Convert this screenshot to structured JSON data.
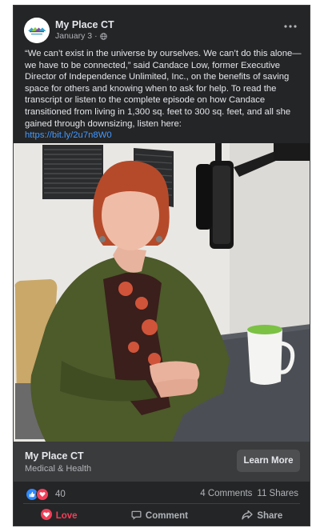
{
  "post": {
    "page_name": "My Place CT",
    "date": "January 3",
    "separator": "·",
    "privacy_icon": "globe-icon",
    "more_icon": "more-horizontal-icon",
    "text": "“We can’t exist in the universe by ourselves. We can’t do this alone—we have to be connected,” said Candace Low, former Executive Director of Independence Unlimited, Inc., on the benefits of saving space for others and knowing when to ask for help. To read the transcript or listen to the complete episode on how Candace transitioned from living in 1,300 sq. feet to 300 sq. feet, and all she gained through downsizing, listen here:",
    "link": "https://bit.ly/2u7n8W0"
  },
  "link_preview": {
    "title": "My Place CT",
    "subtitle": "Medical & Health",
    "button": "Learn More"
  },
  "stats": {
    "reaction_icons": [
      "like-icon",
      "love-icon"
    ],
    "reaction_count": "40",
    "comments": "4 Comments",
    "shares": "11 Shares"
  },
  "actions": {
    "love": "Love",
    "comment": "Comment",
    "share": "Share"
  },
  "colors": {
    "background": "#242526",
    "text": "#e4e6eb",
    "secondary": "#b0b3b8",
    "link": "#4599ff",
    "love": "#f33e58",
    "like": "#2e89ff"
  }
}
